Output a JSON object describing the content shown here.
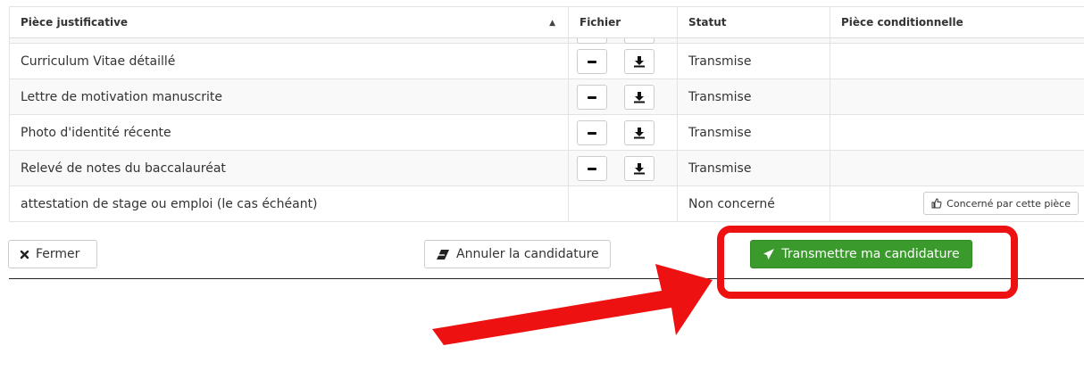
{
  "table": {
    "headers": {
      "piece": "Pièce justificative",
      "fichier": "Fichier",
      "statut": "Statut",
      "conditionnelle": "Pièce conditionnelle"
    },
    "rows": [
      {
        "piece": "Curriculum Vitae détaillé",
        "statut": "Transmise"
      },
      {
        "piece": "Lettre de motivation manuscrite",
        "statut": "Transmise"
      },
      {
        "piece": "Photo d'identité récente",
        "statut": "Transmise"
      },
      {
        "piece": "Relevé de notes du baccalauréat",
        "statut": "Transmise"
      },
      {
        "piece": "attestation de stage ou emploi (le cas échéant)",
        "statut": "Non concerné",
        "conditional_button": "Concerné par cette pièce"
      }
    ]
  },
  "actions": {
    "close_label": "Fermer",
    "cancel_label": "Annuler la candidature",
    "submit_label": "Transmettre ma candidature"
  },
  "colors": {
    "submit_green": "#3a9a2b",
    "highlight_red": "#ee1111"
  },
  "icons": {
    "sort": "sort-asc-icon",
    "remove": "minus-icon",
    "download": "download-icon",
    "thumbs_up": "thumbs-up-icon",
    "close": "times-icon",
    "eraser": "eraser-icon",
    "send": "paper-plane-icon"
  }
}
